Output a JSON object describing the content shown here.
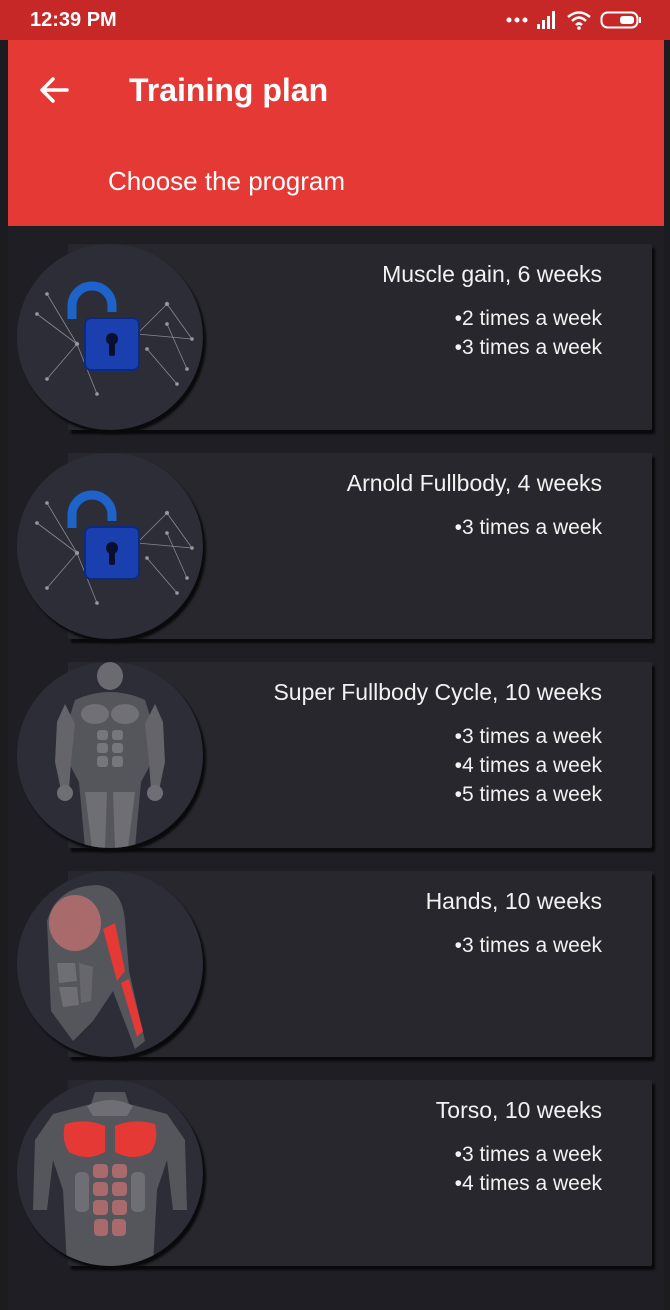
{
  "status_bar": {
    "time": "12:39 PM"
  },
  "app_bar": {
    "title": "Training plan",
    "subtitle": "Choose the program"
  },
  "programs": [
    {
      "title": "Muscle gain, 6 weeks",
      "image": "lock-icon",
      "options": [
        "2 times a week",
        "3 times a week"
      ]
    },
    {
      "title": "Arnold Fullbody, 4 weeks",
      "image": "lock-icon",
      "options": [
        "3 times a week"
      ]
    },
    {
      "title": "Super Fullbody Cycle, 10 weeks",
      "image": "full-body-icon",
      "options": [
        "3 times a week",
        "4 times a week",
        "5 times a week"
      ]
    },
    {
      "title": "Hands, 10 weeks",
      "image": "arm-muscles-icon",
      "options": [
        "3 times a week"
      ]
    },
    {
      "title": "Torso, 10 weeks",
      "image": "torso-muscles-icon",
      "options": [
        "3 times a week",
        "4 times a week"
      ]
    }
  ],
  "colors": {
    "status_bar": "#c62828",
    "app_bar": "#e53935",
    "background": "#1b1b20",
    "card": "#27272d",
    "muscle_highlight": "#e53935"
  }
}
